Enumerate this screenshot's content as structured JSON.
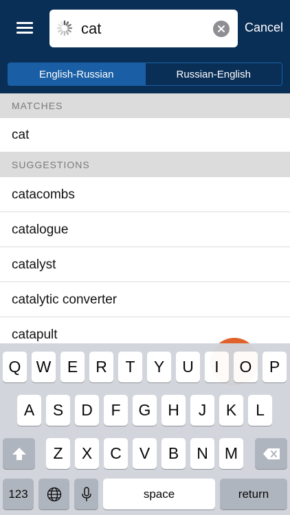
{
  "search": {
    "value": "cat",
    "cancel_label": "Cancel"
  },
  "direction": {
    "options": [
      "English-Russian",
      "Russian-English"
    ],
    "selected": "English-Russian"
  },
  "matches": {
    "header": "MATCHES",
    "items": [
      "cat"
    ]
  },
  "suggestions": {
    "header": "SUGGESTIONS",
    "items": [
      "catacombs",
      "catalogue",
      "catalyst",
      "catalytic converter",
      "catapult"
    ]
  },
  "keyboard": {
    "row1": [
      "Q",
      "W",
      "E",
      "R",
      "T",
      "Y",
      "U",
      "I",
      "O",
      "P"
    ],
    "row2": [
      "A",
      "S",
      "D",
      "F",
      "G",
      "H",
      "J",
      "K",
      "L"
    ],
    "row3": [
      "Z",
      "X",
      "C",
      "V",
      "B",
      "N",
      "M"
    ],
    "numbers_label": "123",
    "space_label": "space",
    "return_label": "return"
  },
  "colors": {
    "header_bg": "#0a2f57",
    "accent": "#1a5fa6",
    "fab": "#e0622a"
  }
}
